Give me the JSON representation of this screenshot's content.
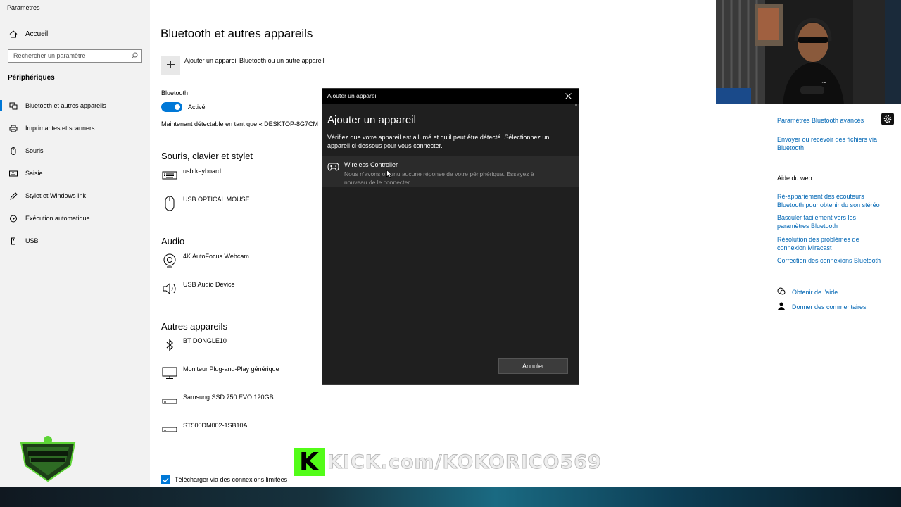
{
  "app": {
    "title": "Paramètres"
  },
  "sidebar": {
    "home_label": "Accueil",
    "search_placeholder": "Rechercher un paramètre",
    "section": "Périphériques",
    "items": [
      {
        "label": "Bluetooth et autres appareils",
        "icon": "bluetooth-devices-icon"
      },
      {
        "label": "Imprimantes et scanners",
        "icon": "printer-icon"
      },
      {
        "label": "Souris",
        "icon": "mouse-icon"
      },
      {
        "label": "Saisie",
        "icon": "keyboard-icon"
      },
      {
        "label": "Stylet et Windows Ink",
        "icon": "pen-icon"
      },
      {
        "label": "Exécution automatique",
        "icon": "autoplay-icon"
      },
      {
        "label": "USB",
        "icon": "usb-icon"
      }
    ]
  },
  "main": {
    "title": "Bluetooth et autres appareils",
    "add_device_label": "Ajouter un appareil Bluetooth ou un autre appareil",
    "bluetooth_label": "Bluetooth",
    "bluetooth_state": "Activé",
    "discoverable_text": "Maintenant détectable en tant que « DESKTOP-8G7CM",
    "groups": {
      "mouse_keyboard": {
        "title": "Souris, clavier et stylet",
        "devices": [
          "usb keyboard",
          "USB OPTICAL MOUSE"
        ]
      },
      "audio": {
        "title": "Audio",
        "devices": [
          "4K AutoFocus Webcam",
          "USB Audio Device"
        ]
      },
      "other": {
        "title": "Autres appareils",
        "devices": [
          "BT DONGLE10",
          "Moniteur Plug-and-Play générique",
          "Samsung SSD 750 EVO 120GB",
          "ST500DM002-1SB10A"
        ]
      }
    },
    "metered_label": "Télécharger via des connexions limitées"
  },
  "related": {
    "links": [
      "Paramètres Bluetooth avancés",
      "Envoyer ou recevoir des fichiers via Bluetooth"
    ],
    "help_title": "Aide du web",
    "help_links": [
      "Ré-appariement des écouteurs Bluetooth pour obtenir du son stéréo",
      "Basculer facilement vers les paramètres Bluetooth",
      "Résolution des problèmes de connexion Miracast",
      "Correction des connexions Bluetooth"
    ],
    "get_help": "Obtenir de l'aide",
    "feedback": "Donner des commentaires"
  },
  "dialog": {
    "window_title": "Ajouter un appareil",
    "heading": "Ajouter un appareil",
    "description": "Vérifiez que votre appareil est allumé et qu'il peut être détecté. Sélectionnez un appareil ci-dessous pour vous connecter.",
    "device_name": "Wireless Controller",
    "device_status": "Nous n'avons obtenu aucune réponse de votre périphérique. Essayez à nouveau de le connecter.",
    "cancel_label": "Annuler"
  },
  "overlay": {
    "kick_k": "K",
    "kick_text": "KICK.com/KOKORICO569"
  },
  "colors": {
    "accent": "#0078d7",
    "link": "#0066b4",
    "kick_green": "#53fc18",
    "dialog_bg": "#1f1f1f"
  }
}
